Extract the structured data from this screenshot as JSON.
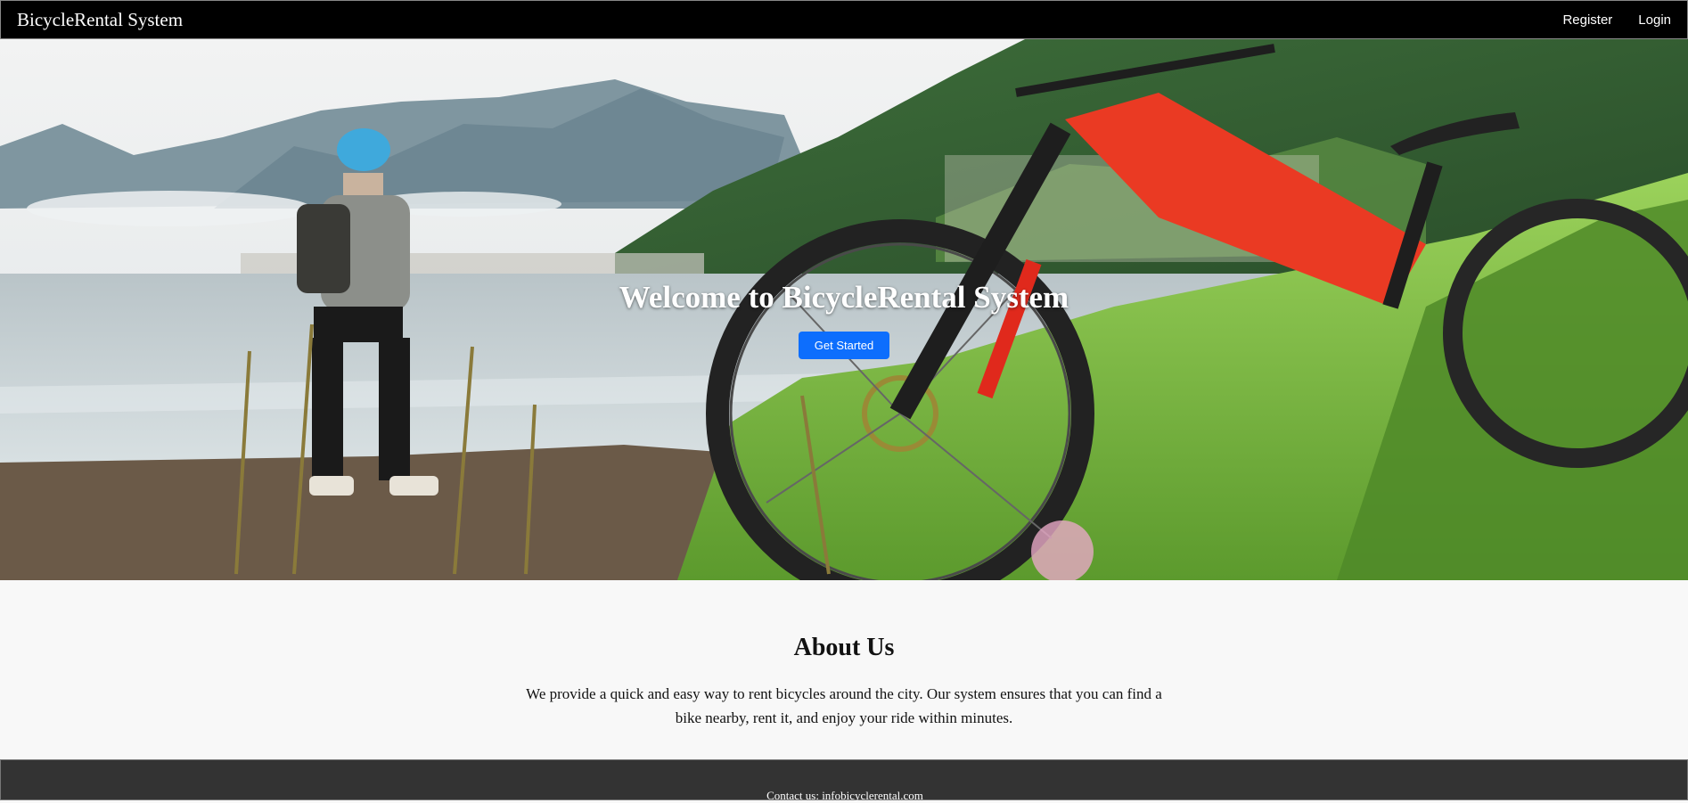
{
  "navbar": {
    "brand": "BicycleRental System",
    "links": [
      {
        "label": "Register"
      },
      {
        "label": "Login"
      }
    ]
  },
  "hero": {
    "title": "Welcome to BicycleRental System",
    "cta_label": "Get Started",
    "image_subject": "Cyclist standing by a mountain lake with a red mountain bike in tall grass"
  },
  "about": {
    "title": "About Us",
    "text": "We provide a quick and easy way to rent bicycles around the city. Our system ensures that you can find a bike nearby, rent it, and enjoy your ride within minutes."
  },
  "footer": {
    "contact": "Contact us: infobicyclerental.com"
  },
  "colors": {
    "navbar_bg": "#000000",
    "accent": "#0d6efd",
    "footer_bg": "#333333",
    "page_bg": "#f8f8f8"
  }
}
